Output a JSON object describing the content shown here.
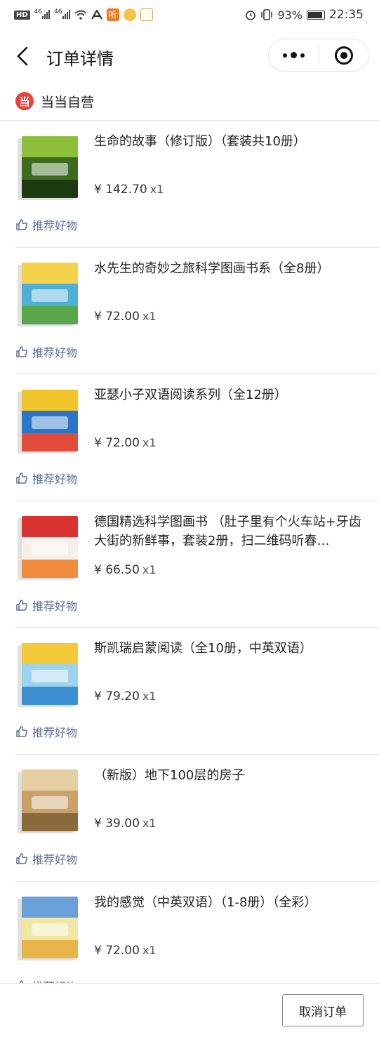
{
  "status_bar": {
    "hd_label": "HD",
    "signal1_label": "46",
    "signal2_label": "46",
    "battery_percent": "93%",
    "time": "22:35",
    "app_badge": "听"
  },
  "nav": {
    "title": "订单详情"
  },
  "shop": {
    "logo_char": "当",
    "name": "当当自营"
  },
  "recommend_label": "推荐好物",
  "currency": "¥",
  "products": [
    {
      "title": "生命的故事（修订版）（套装共10册）",
      "price": "¥ 142.70",
      "qty": "x1",
      "cover_colors": [
        "#3d6b1f",
        "#8ebf3a",
        "#1c3a10"
      ]
    },
    {
      "title": "水先生的奇妙之旅科学图画书系（全8册）",
      "price": "¥ 72.00",
      "qty": "x1",
      "cover_colors": [
        "#4fb0d6",
        "#f4d24a",
        "#5aa64a"
      ]
    },
    {
      "title": "亚瑟小子双语阅读系列（全12册）",
      "price": "¥ 72.00",
      "qty": "x1",
      "cover_colors": [
        "#2a74c9",
        "#f0c62c",
        "#e14b3b"
      ]
    },
    {
      "title": "德国精选科学图画书 （肚子里有个火车站+牙齿大街的新鲜事，套装2册，扫二维码听春…",
      "price": "¥ 66.50",
      "qty": "x1",
      "cover_colors": [
        "#f4f1ea",
        "#d9332f",
        "#f08a3c"
      ]
    },
    {
      "title": "斯凯瑞启蒙阅读（全10册，中英双语）",
      "price": "¥ 79.20",
      "qty": "x1",
      "cover_colors": [
        "#9ed3ee",
        "#f3c93a",
        "#3b8fd0"
      ]
    },
    {
      "title": "（新版）地下100层的房子",
      "price": "¥ 39.00",
      "qty": "x1",
      "cover_colors": [
        "#c9a06a",
        "#e6cfa2",
        "#8a6a3d"
      ]
    },
    {
      "title": "我的感觉（中英双语）（1-8册）（全彩）",
      "price": "¥ 72.00",
      "qty": "x1",
      "cover_colors": [
        "#f1e6a6",
        "#6aa0d8",
        "#e8b54a"
      ]
    }
  ],
  "bottom": {
    "cancel_label": "取消订单"
  }
}
